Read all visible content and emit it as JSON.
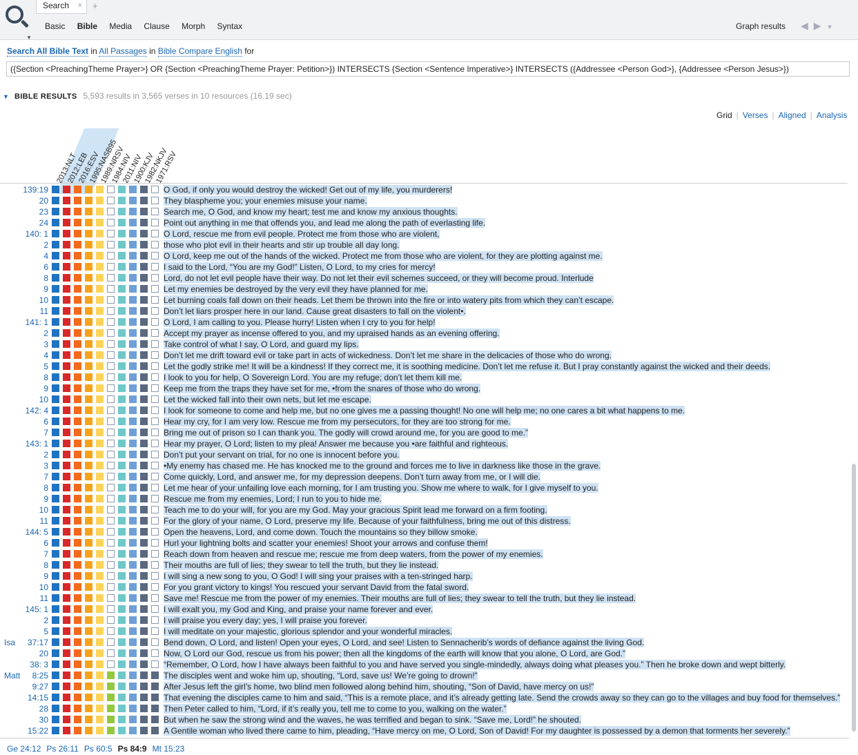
{
  "tab": {
    "label": "Search",
    "close": "×",
    "add": "+"
  },
  "nav": [
    "Basic",
    "Bible",
    "Media",
    "Clause",
    "Morph",
    "Syntax"
  ],
  "nav_active": "Bible",
  "graph_results": "Graph results",
  "query": {
    "w1": "Search",
    "w2": "All Bible Text",
    "w3": "in",
    "w4": "All Passages",
    "w5": "in",
    "w6": "Bible Compare English",
    "w7": "for",
    "text": "({Section <PreachingTheme Prayer>} OR {Section <PreachingTheme Prayer: Petition>}) INTERSECTS {Section <Sentence Imperative>} INTERSECTS ({Addressee <Person God>}, {Addressee <Person Jesus>})"
  },
  "results": {
    "title": "BIBLE RESULTS",
    "stats": "5,593 results in 3,565 verses in 10 resources (16.19 sec)"
  },
  "views": [
    "Grid",
    "Verses",
    "Aligned",
    "Analysis"
  ],
  "columns": [
    "2013:NLT",
    "2012:LEB",
    "2016:ESV",
    "1995:NASB95",
    "1989:NRSV",
    "1984:NIV",
    "2011:NIV",
    "1900:KJV",
    "1982:NKJV",
    "1971:RSV"
  ],
  "palette": {
    "a": "#1f73c0",
    "b": "#d8282a",
    "c": "#f26a1b",
    "d": "#f7a21b",
    "e": "#fdd35a",
    "f": "#93c83e",
    "g": "#6fc7c9",
    "h": "#6f9fd6",
    "i": "#5a6880",
    "o": "#ffffff"
  },
  "rows": [
    {
      "book": "",
      "ref": "139:19",
      "pat": "abcdeoghio",
      "text": "O God, if only you would destroy the wicked! Get out of my life, you murderers!"
    },
    {
      "book": "",
      "ref": "20",
      "pat": "abcdeoghio",
      "text": "They blaspheme you; your enemies misuse your name."
    },
    {
      "book": "",
      "ref": "23",
      "pat": "abcdeoghio",
      "text": "Search me, O God, and know my heart; test me and know my anxious thoughts."
    },
    {
      "book": "",
      "ref": "24",
      "pat": "abcdeoghio",
      "text": "Point out anything in me that offends you, and lead me along the path of everlasting life."
    },
    {
      "book": "",
      "ref": "140:  1",
      "pat": "abcdeoghio",
      "text": "O Lord, rescue me from evil people. Protect me from those who are violent,"
    },
    {
      "book": "",
      "ref": "2",
      "pat": "abcdeoghio",
      "text": "those who plot evil in their hearts and stir up trouble all day long."
    },
    {
      "book": "",
      "ref": "4",
      "pat": "abcdeoghio",
      "text": "O Lord, keep me out of the hands of the wicked. Protect me from those who are violent, for they are plotting against me."
    },
    {
      "book": "",
      "ref": "6",
      "pat": "abcdeoghio",
      "text": "I said to the Lord, “You are my God!” Listen, O Lord, to my cries for mercy!"
    },
    {
      "book": "",
      "ref": "8",
      "pat": "abcdeoghio",
      "text": "Lord, do not let evil people have their way. Do not let their evil schemes succeed, or they will become proud. Interlude"
    },
    {
      "book": "",
      "ref": "9",
      "pat": "abcdeoghio",
      "text": "Let my enemies be destroyed by the very evil they have planned for me."
    },
    {
      "book": "",
      "ref": "10",
      "pat": "abcdeoghio",
      "text": "Let burning coals fall down on their heads. Let them be thrown into the fire or into watery pits from which they can’t escape."
    },
    {
      "book": "",
      "ref": "11",
      "pat": "abcdeoghio",
      "text": "Don’t let liars prosper here in our land. Cause great disasters to fall on the violent•."
    },
    {
      "book": "",
      "ref": "141:  1",
      "pat": "abcdeoghio",
      "text": "O Lord, I am calling to you. Please hurry! Listen when I cry to you for help!"
    },
    {
      "book": "",
      "ref": "2",
      "pat": "abcdeoghio",
      "text": "Accept my prayer as incense offered to you, and my upraised hands as an evening offering."
    },
    {
      "book": "",
      "ref": "3",
      "pat": "abcdeoghio",
      "text": "Take control of what I say, O Lord, and guard my lips."
    },
    {
      "book": "",
      "ref": "4",
      "pat": "abcdeoghio",
      "text": "Don’t let me drift toward evil or take part in acts of wickedness. Don’t let me share in the delicacies of those who do wrong."
    },
    {
      "book": "",
      "ref": "5",
      "pat": "abcdeoghio",
      "text": "Let the godly strike me! It will be a kindness! If they correct me, it is soothing medicine. Don’t let me refuse it. But I pray constantly against the wicked and their deeds."
    },
    {
      "book": "",
      "ref": "8",
      "pat": "abcdeoghio",
      "text": "I look to you for help, O Sovereign Lord. You are my refuge; don’t let them kill me."
    },
    {
      "book": "",
      "ref": "9",
      "pat": "abcdeoghio",
      "text": "Keep me from the traps they have set for me, •from the snares of those who do wrong."
    },
    {
      "book": "",
      "ref": "10",
      "pat": "abcdeoghio",
      "text": "Let the wicked fall into their own nets, but let me escape."
    },
    {
      "book": "",
      "ref": "142:  4",
      "pat": "abcdeoghio",
      "text": "I look for someone to come and help me, but no one gives me a passing thought! No one will help me; no one cares a bit what happens to me."
    },
    {
      "book": "",
      "ref": "6",
      "pat": "abcdeoghio",
      "text": "Hear my cry, for I am very low. Rescue me from my persecutors, for they are too strong for me."
    },
    {
      "book": "",
      "ref": "7",
      "pat": "abcdeoghio",
      "text": "Bring me out of prison so I can thank you. The godly will crowd around me, for you are good to me.”"
    },
    {
      "book": "",
      "ref": "143:  1",
      "pat": "abcdeoghio",
      "text": "Hear my prayer, O Lord; listen to my plea! Answer me because you •are faithful and righteous."
    },
    {
      "book": "",
      "ref": "2",
      "pat": "abcdeoghio",
      "text": "Don’t put your servant on trial, for no one is innocent before you."
    },
    {
      "book": "",
      "ref": "3",
      "pat": "abcdeoghio",
      "text": "•My enemy has chased me. He has knocked me to the ground and forces me to live in darkness like those in the grave."
    },
    {
      "book": "",
      "ref": "7",
      "pat": "abcdeoghio",
      "text": "Come quickly, Lord, and answer me, for my depression deepens. Don’t turn away from me, or I will die."
    },
    {
      "book": "",
      "ref": "8",
      "pat": "abcdeoghio",
      "text": "Let me hear of your unfailing love each morning, for I am trusting you. Show me where to walk, for I give myself to you."
    },
    {
      "book": "",
      "ref": "9",
      "pat": "abcdeoghio",
      "text": "Rescue me from my enemies, Lord; I run to you to hide me."
    },
    {
      "book": "",
      "ref": "10",
      "pat": "abcdeoghio",
      "text": "Teach me to do your will, for you are my God. May your gracious Spirit lead me forward on a firm footing."
    },
    {
      "book": "",
      "ref": "11",
      "pat": "abcdeoghio",
      "text": "For the glory of your name, O Lord, preserve my life. Because of your faithfulness, bring me out of this distress."
    },
    {
      "book": "",
      "ref": "144:  5",
      "pat": "abcdeoghio",
      "text": "Open the heavens, Lord, and come down. Touch the mountains so they billow smoke."
    },
    {
      "book": "",
      "ref": "6",
      "pat": "abcdeoghio",
      "text": "Hurl your lightning bolts and scatter your enemies! Shoot your arrows and confuse them!"
    },
    {
      "book": "",
      "ref": "7",
      "pat": "abcdeoghio",
      "text": "Reach down from heaven and rescue me; rescue me from deep waters, from the power of my enemies."
    },
    {
      "book": "",
      "ref": "8",
      "pat": "abcdeoghio",
      "text": "Their mouths are full of lies; they swear to tell the truth, but they lie instead."
    },
    {
      "book": "",
      "ref": "9",
      "pat": "abcdeoghio",
      "text": "I will sing a new song to you, O God! I will sing your praises with a ten-stringed harp."
    },
    {
      "book": "",
      "ref": "10",
      "pat": "abcdeoghio",
      "text": "For you grant victory to kings! You rescued your servant David from the fatal sword."
    },
    {
      "book": "",
      "ref": "11",
      "pat": "abcdeoghio",
      "text": "Save me! Rescue me from the power of my enemies. Their mouths are full of lies; they swear to tell the truth, but they lie instead."
    },
    {
      "book": "",
      "ref": "145:  1",
      "pat": "abcdeoghio",
      "text": "I will exalt you, my God and King, and praise your name forever and ever."
    },
    {
      "book": "",
      "ref": "2",
      "pat": "abcdeoghio",
      "text": "I will praise you every day; yes, I will praise you forever."
    },
    {
      "book": "",
      "ref": "5",
      "pat": "abcdeoghio",
      "text": "I will meditate on your majestic, glorious splendor and your wonderful miracles."
    },
    {
      "book": "Isa",
      "ref": "37:17",
      "pat": "abcdeoghio",
      "text": "Bend down, O Lord, and listen! Open your eyes, O Lord, and see! Listen to Sennacherib’s words of defiance against the living God."
    },
    {
      "book": "",
      "ref": "20",
      "pat": "abcdeoghio",
      "text": "Now, O Lord our God, rescue us from his power; then all the kingdoms of the earth will know that you alone, O Lord, are God.”"
    },
    {
      "book": "",
      "ref": "38:  3",
      "pat": "abcdeoghio",
      "text": "“Remember, O Lord, how I have always been faithful to you and have served you single-mindedly, always doing what pleases you.” Then he broke down and wept bitterly."
    },
    {
      "book": "Matt",
      "ref": "8:25",
      "pat": "abcdefghii",
      "text": "The disciples went and woke him up, shouting, “Lord, save us! We’re going to drown!”"
    },
    {
      "book": "",
      "ref": "9:27",
      "pat": "abcdefghii",
      "text": "After Jesus left the girl’s home, two blind men followed along behind him, shouting, “Son of David, have mercy on us!”"
    },
    {
      "book": "",
      "ref": "14:15",
      "pat": "abcdefghii",
      "text": "That evening the disciples came to him and said, “This is a remote place, and it’s already getting late. Send the crowds away so they can go to the villages and buy food for themselves.”"
    },
    {
      "book": "",
      "ref": "28",
      "pat": "abcdefghii",
      "text": "Then Peter called to him, “Lord, if it’s really you, tell me to come to you, walking on the water.”"
    },
    {
      "book": "",
      "ref": "30",
      "pat": "abcdefghii",
      "text": "But when he saw the strong wind and the waves, he was terrified and began to sink. “Save me, Lord!” he shouted."
    },
    {
      "book": "",
      "ref": "15:22",
      "pat": "abcdefghii",
      "text": "A Gentile woman who lived there came to him, pleading, “Have mercy on me, O Lord, Son of David! For my daughter is possessed by a demon that torments her severely.”"
    }
  ],
  "footer": [
    "Ge 24:12",
    "Ps 26:11",
    "Ps 60:5",
    "Ps 84:9",
    "Mt 15:23"
  ],
  "footer_current": "Ps 84:9"
}
